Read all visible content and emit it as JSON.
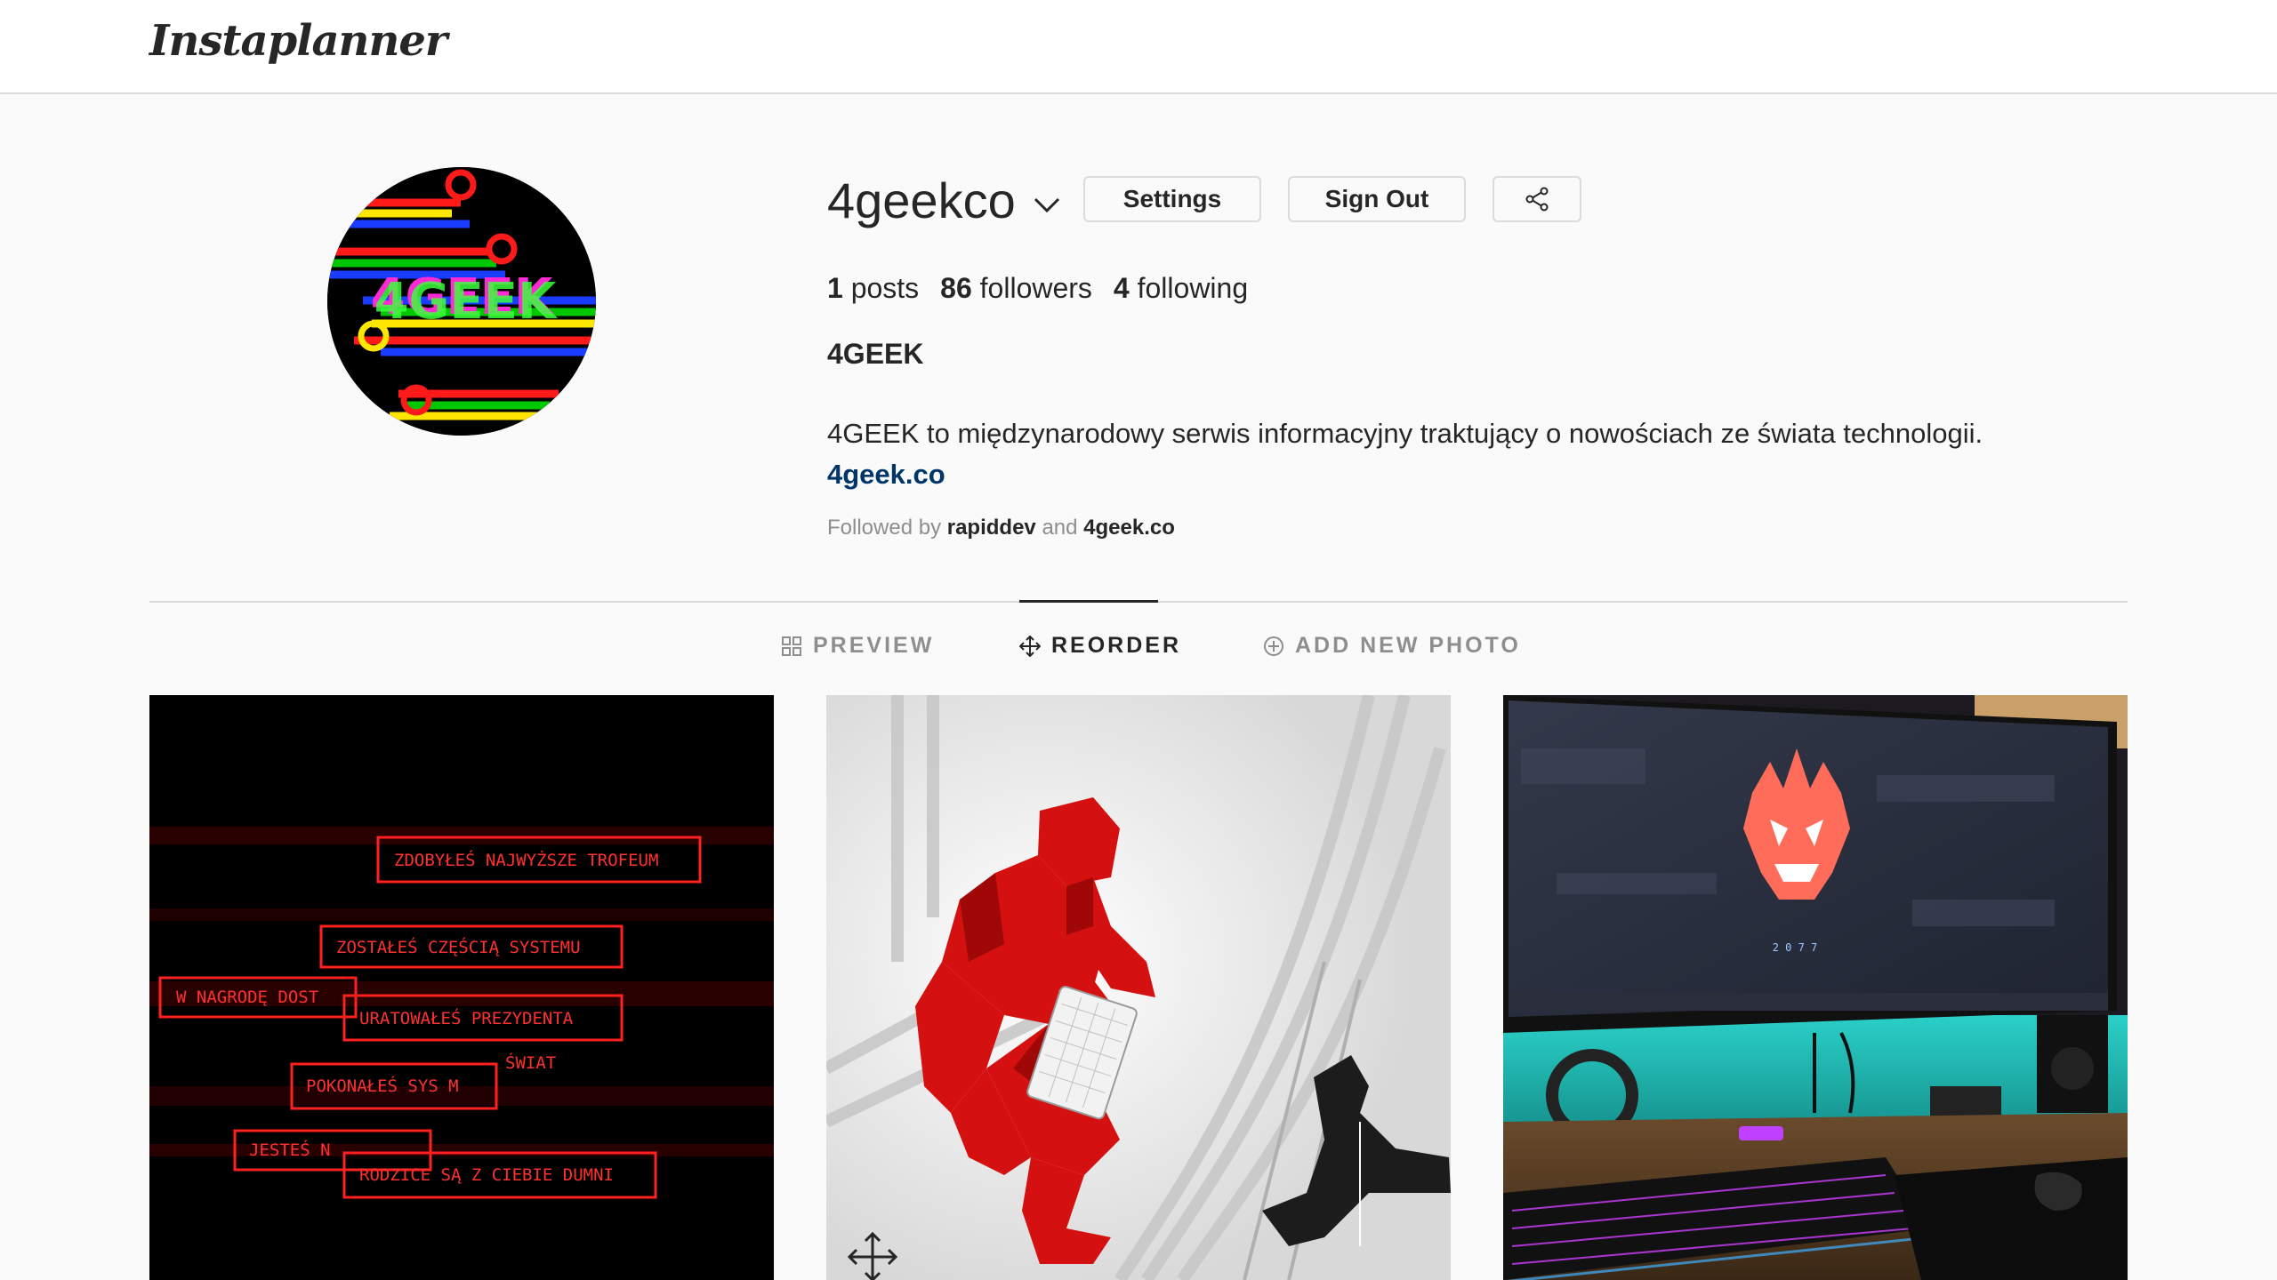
{
  "app": {
    "logo": "Instaplanner"
  },
  "profile": {
    "username": "4geekco",
    "posts_count": "1",
    "posts_label": "posts",
    "followers_count": "86",
    "followers_label": "followers",
    "following_count": "4",
    "following_label": "following",
    "full_name": "4GEEK",
    "bio": "4GEEK to międzynarodowy serwis informacyjny traktujący o nowościach ze świata technologii.",
    "website": "4geek.co",
    "followed_by_prefix": "Followed by",
    "followed_by_user1": "rapiddev",
    "followed_by_and": "and",
    "followed_by_user2": "4geek.co",
    "avatar_text": "4GEEK"
  },
  "buttons": {
    "settings": "Settings",
    "sign_out": "Sign Out"
  },
  "tabs": [
    {
      "label": "PREVIEW",
      "icon": "grid-icon",
      "active": false
    },
    {
      "label": "REORDER",
      "icon": "move-icon",
      "active": true
    },
    {
      "label": "ADD NEW PHOTO",
      "icon": "plus-circle-icon",
      "active": false
    }
  ],
  "posts": {
    "post1_lines": [
      "ZDOBYŁEŚ NAJWYŻSZE TROFEUM",
      "ZOSTAŁEŚ CZĘŚCIĄ SYSTEMU",
      "W NAGRODĘ DOST",
      "URATOWAŁEŚ PREZYDENTA",
      "ŚWIAT",
      "POKONAŁEŚ SYS  M",
      "JESTEŚ N",
      "RODZICE SĄ Z CIEBIE DUMNI"
    ],
    "post3_caption": "2 0 7 7"
  },
  "colors": {
    "accent": "#003569",
    "text": "#262626",
    "muted": "#8e8e8e",
    "border": "#dbdbdb",
    "background": "#fafafa"
  }
}
